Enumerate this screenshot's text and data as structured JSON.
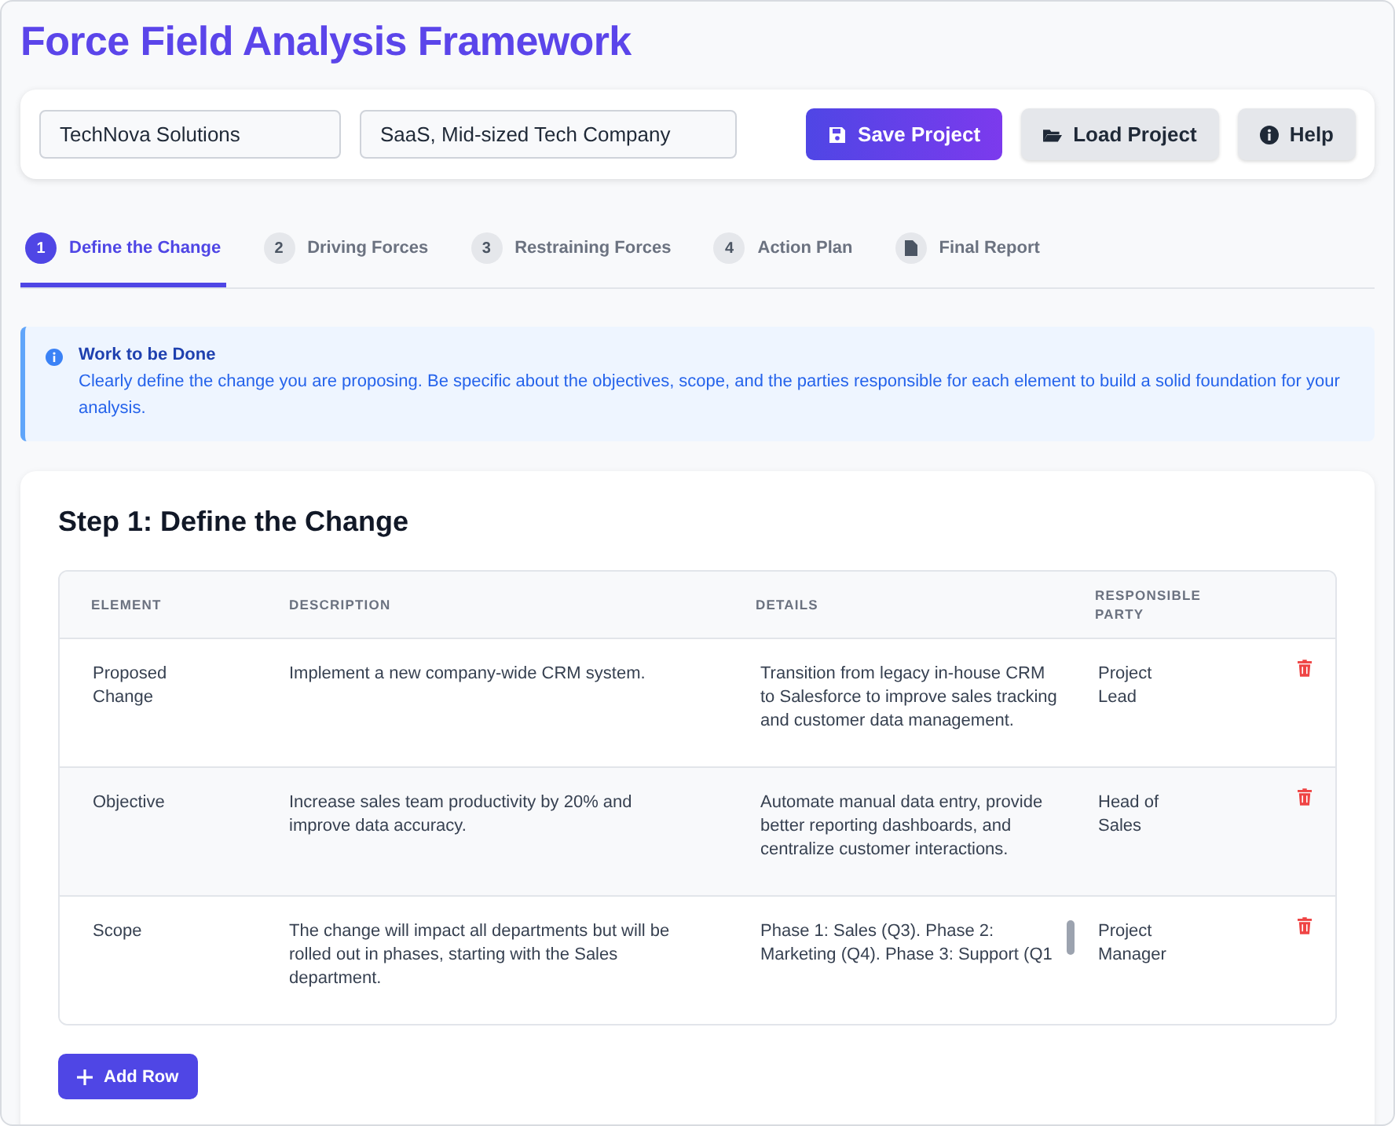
{
  "title": "Force Field Analysis Framework",
  "header": {
    "fields": [
      {
        "value": "TechNova Solutions"
      },
      {
        "value": "SaaS, Mid-sized Tech Company"
      }
    ],
    "buttons": [
      {
        "label": "Save Project",
        "kind": "primary"
      },
      {
        "label": "Load Project",
        "kind": "secondary"
      },
      {
        "label": "Help",
        "kind": "secondary"
      }
    ]
  },
  "tabs": [
    {
      "badge": "1",
      "label": "Define the Change",
      "selected": true
    },
    {
      "badge": "2",
      "label": "Driving Forces",
      "selected": false
    },
    {
      "badge": "3",
      "label": "Restraining Forces",
      "selected": false
    },
    {
      "badge": "4",
      "label": "Action Plan",
      "selected": false
    },
    {
      "label": "Final Report",
      "selected": false
    }
  ],
  "notice": {
    "title": "Work to be Done",
    "text": "Clearly define the change you are proposing. Be specific about the objectives, scope, and the parties responsible for each element to build a solid foundation for your analysis."
  },
  "step": {
    "heading": "Step 1: Define the Change",
    "columns": [
      "ELEMENT",
      "DESCRIPTION",
      "DETAILS",
      "RESPONSIBLE PARTY"
    ],
    "rows": [
      {
        "element": "Proposed Change",
        "description": "Implement a new company-wide CRM system.",
        "details": "Transition from legacy in-house CRM to Salesforce to improve sales tracking and customer data management.",
        "responsible": "Project Lead",
        "hovered": false,
        "details_scrollable": false
      },
      {
        "element": "Objective",
        "description": "Increase sales team productivity by 20% and improve data accuracy.",
        "details": "Automate manual data entry, provide better reporting dashboards, and centralize customer interactions.",
        "responsible": "Head of Sales",
        "hovered": true,
        "details_scrollable": false
      },
      {
        "element": "Scope",
        "description": "The change will impact all departments but will be rolled out in phases, starting with the Sales department.",
        "details": "Phase 1: Sales (Q3). Phase 2: Marketing (Q4). Phase 3: Support (Q1",
        "responsible": "Project Manager",
        "hovered": false,
        "details_scrollable": true
      }
    ],
    "add_button": "Add Row"
  }
}
